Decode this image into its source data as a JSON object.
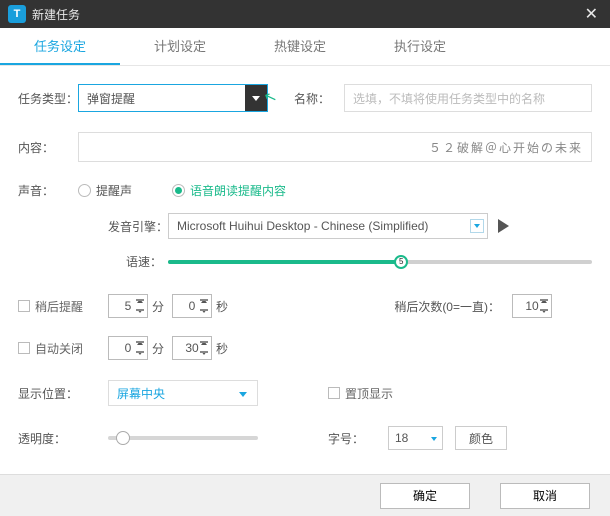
{
  "title": "新建任务",
  "tabs": {
    "task": "任务设定",
    "plan": "计划设定",
    "hotkey": "热键设定",
    "exec": "执行设定"
  },
  "labels": {
    "taskType": "任务类型：",
    "name": "名称：",
    "contentLbl": "内容：",
    "sound": "声音：",
    "tts_engine": "发音引擎：",
    "speed": "语速：",
    "later": "稍后提醒",
    "laterMin": "分",
    "laterSec": "秒",
    "laterCount": "稍后次数(0=一直)：",
    "autoClose": "自动关闭",
    "position": "显示位置：",
    "ontop": "置顶显示",
    "opacity": "透明度：",
    "fontSize": "字号：",
    "color": "颜色"
  },
  "values": {
    "taskType": "弹窗提醒",
    "namePlaceholder": "选填，不填将使用任务类型中的名称",
    "contentText": "５２破解＠心开始の未来",
    "opt_beep": "提醒声",
    "opt_tts": "语音朗读提醒内容",
    "engine": "Microsoft Huihui Desktop - Chinese (Simplified)",
    "speedValue": "5",
    "later_min": "5",
    "later_sec": "0",
    "later_count": "10",
    "close_min": "0",
    "close_sec": "30",
    "position": "屏幕中央",
    "font_size": "18"
  },
  "buttons": {
    "ok": "确定",
    "cancel": "取消"
  }
}
